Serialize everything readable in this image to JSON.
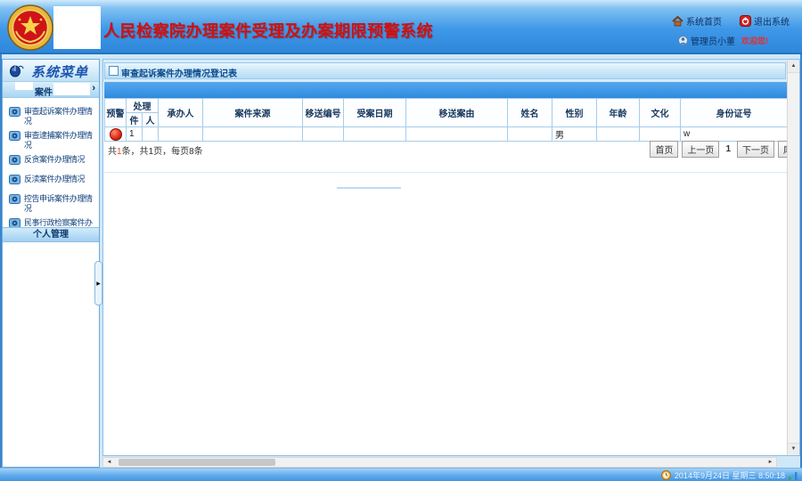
{
  "theme": {
    "header_blue": "#3f98e8",
    "title_red": "#cf1010",
    "band_blue": "#2e8adf",
    "warning_red": "#e03018",
    "sidebar_text_blue": "#11407c",
    "statusbar_blue": "#5da8ec"
  },
  "header": {
    "title": "人民检察院办理案件受理及办案期限预警系统",
    "nav_home": "系统首页",
    "nav_logout": "退出系统",
    "user_name": "管理员小董",
    "welcome": "欢迎您!"
  },
  "sidebar": {
    "menu_title": "系统菜单",
    "case_section": "案件",
    "items": [
      {
        "label": "审查起诉案件办理情况"
      },
      {
        "label": "审查逮捕案件办理情况"
      },
      {
        "label": "反贪案件办理情况"
      },
      {
        "label": "反渎案件办理情况"
      },
      {
        "label": "控告申诉案件办理情况"
      },
      {
        "label": "民事行政检察案件办理情况"
      }
    ],
    "personal_section": "个人管理"
  },
  "main": {
    "panel_title": "审查起诉案件办理情况登记表",
    "table": {
      "col_warning": "预警",
      "col_handle": "处理",
      "col_handle_item": "件",
      "col_handle_person": "人",
      "col_handler": "承办人",
      "col_case_source": "案件来源",
      "col_transfer_no": "移送编号",
      "col_accept_date": "受案日期",
      "col_transfer_reason": "移送案由",
      "col_name": "姓名",
      "col_gender": "性别",
      "col_age": "年龄",
      "col_education": "文化",
      "col_id_number": "身份证号",
      "row": {
        "handle_item": "1",
        "gender": "男",
        "id_number": "w"
      }
    },
    "pagination": {
      "total_prefix": "共",
      "total_count": "1",
      "total_mid": "条，共",
      "total_pages": "1",
      "total_suffix": "页，每页8条",
      "first": "首页",
      "prev": "上一页",
      "current": "1",
      "next": "下一页",
      "last": "尾页"
    }
  },
  "statusbar": {
    "datetime": "2014年9月24日 星期三 8:50:18"
  },
  "icons": {
    "logo": "procuratorate-emblem-logo",
    "home": "house-icon",
    "logout": "power-icon",
    "user": "person-icon",
    "menu_header": "mouse-icon",
    "menu_item": "monitor-icon",
    "warning": "warning-dot-icon",
    "clock": "clock-icon",
    "corner": "signal-bars-icon"
  }
}
